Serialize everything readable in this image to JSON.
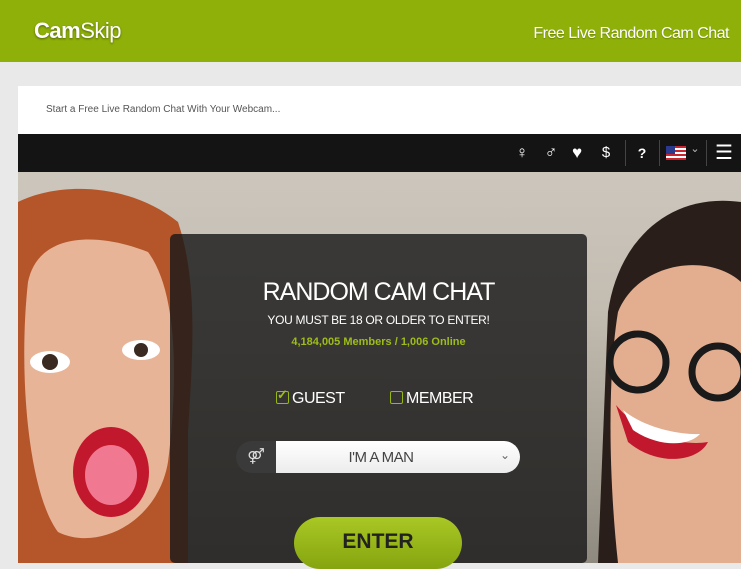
{
  "brand": {
    "logo_bold": "Cam",
    "logo_light": "Skip",
    "tagline": "Free Live Random Cam Chat"
  },
  "subtitle": "Start a Free Live Random Chat With Your Webcam...",
  "toolbar": {
    "female_icon": "♀",
    "male_icon": "♂",
    "heart_icon": "♥",
    "dollar_icon": "$",
    "help_icon": "?",
    "chevron": "⌄",
    "menu_icon": "☰"
  },
  "panel": {
    "title": "RANDOM CAM CHAT",
    "age_warning": "YOU MUST BE 18 OR OLDER TO ENTER!",
    "count": "4,184,005 Members / 1,006 Online",
    "guest_label": "GUEST",
    "member_label": "MEMBER",
    "gender_glyph": "⚤",
    "gender_value": "I'M A MAN",
    "select_caret": "⌄",
    "enter_label": "ENTER"
  },
  "colors": {
    "accent": "#8fb008",
    "toolbar": "#141414",
    "highlight": "#9dbd19"
  }
}
